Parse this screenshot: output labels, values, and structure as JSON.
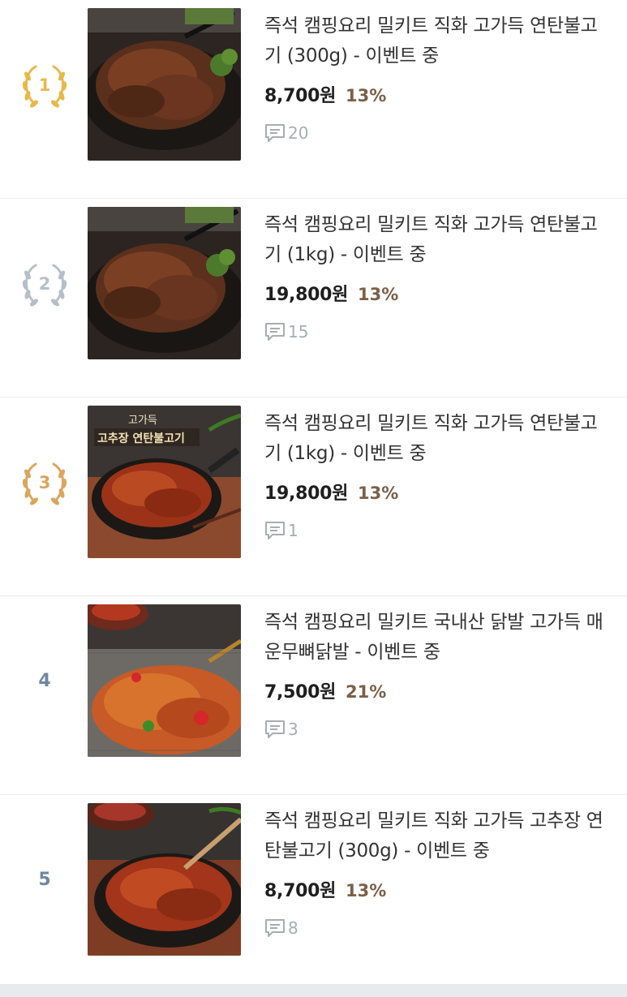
{
  "products": [
    {
      "rank": "1",
      "rank_style": "gold",
      "title": "즉석 캠핑요리 밀키트 직화 고가득 연탄불고기 (300g) - 이벤트 중",
      "price": "8,700원",
      "discount": "13%",
      "review_count": "20",
      "image": "bulgogi-plate-photo"
    },
    {
      "rank": "2",
      "rank_style": "silver",
      "title": "즉석 캠핑요리 밀키트 직화 고가득 연탄불고기 (1kg) - 이벤트 중",
      "price": "19,800원",
      "discount": "13%",
      "review_count": "15",
      "image": "bulgogi-plate-photo"
    },
    {
      "rank": "3",
      "rank_style": "bronze",
      "title": "즉석 캠핑요리 밀키트 직화 고가득 연탄불고기 (1kg) - 이벤트 중",
      "price": "19,800원",
      "discount": "13%",
      "review_count": "1",
      "image": "spicy-bulgogi-pan-photo",
      "image_text": [
        "고가득",
        "고추장 연탄불고기"
      ]
    },
    {
      "rank": "4",
      "rank_style": "plain",
      "title": "즉석 캠핑요리 밀키트 국내산 닭발 고가득 매운무뼈닭발 - 이벤트 중",
      "price": "7,500원",
      "discount": "21%",
      "review_count": "3",
      "image": "spicy-chicken-feet-grill-photo"
    },
    {
      "rank": "5",
      "rank_style": "plain",
      "title": "즉석 캠핑요리 밀키트 직화 고가득 고추장 연탄불고기 (300g) - 이벤트 중",
      "price": "8,700원",
      "discount": "13%",
      "review_count": "8",
      "image": "spicy-bulgogi-plate-photo"
    }
  ],
  "colors": {
    "gold": "#e6b94a",
    "silver": "#b6bfc8",
    "bronze": "#d9a65d",
    "rank_plain": "#6f86a3",
    "discount": "#7a5f47",
    "review": "#a8adb3"
  }
}
